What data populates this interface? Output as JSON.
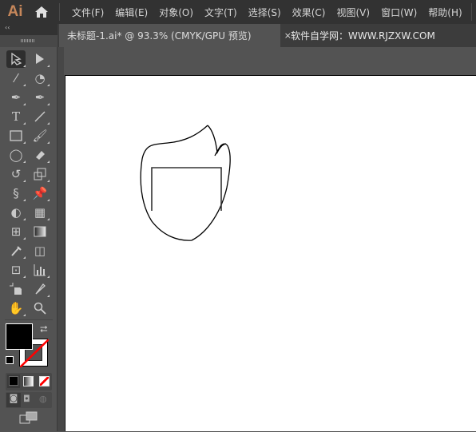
{
  "app": {
    "logo": "Ai"
  },
  "menu": [
    "文件(F)",
    "编辑(E)",
    "对象(O)",
    "文字(T)",
    "选择(S)",
    "效果(C)",
    "视图(V)",
    "窗口(W)",
    "帮助(H)"
  ],
  "tabs": [
    {
      "label": "未标题-1.ai* @ 93.3% (CMYK/GPU 预览)",
      "close": "×"
    },
    {
      "label": "软件自学网：WWW.RJZXW.COM"
    }
  ],
  "toolbar": {
    "collapse": "‹‹",
    "tools": [
      "selection-tool",
      "direct-selection-tool",
      "magic-wand-tool",
      "lasso-tool",
      "pen-tool",
      "curvature-tool",
      "type-tool",
      "line-segment-tool",
      "rectangle-tool",
      "paintbrush-tool",
      "shaper-tool",
      "eraser-tool",
      "rotate-tool",
      "scale-tool",
      "warp-tool",
      "puppet-warp-tool",
      "shape-builder-tool",
      "perspective-grid-tool",
      "mesh-tool",
      "gradient-tool",
      "eyedropper-tool",
      "blend-tool",
      "symbol-sprayer-tool",
      "column-graph-tool",
      "artboard-tool",
      "slice-tool",
      "hand-tool",
      "zoom-tool"
    ],
    "type_glyph": "T",
    "fill_color": "#000000",
    "stroke_color": "none",
    "accent_none": "#ff0000"
  },
  "colors": {
    "brand": "#c6875a",
    "menubar": "#323232",
    "panel": "#535353",
    "canvas": "#ffffff"
  }
}
